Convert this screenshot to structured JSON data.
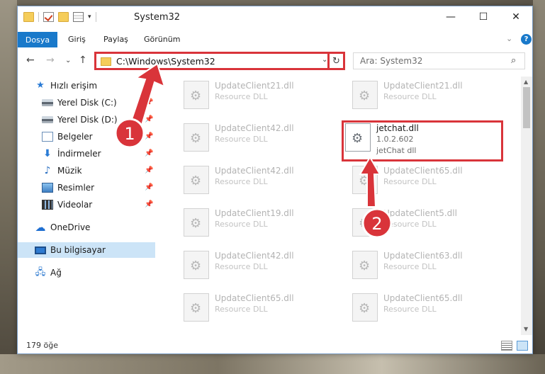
{
  "window": {
    "title": "System32",
    "minimize": "—",
    "maximize": "☐",
    "close": "✕"
  },
  "ribbon": {
    "tabs": [
      "Dosya",
      "Giriş",
      "Paylaş",
      "Görünüm"
    ],
    "collapse": "⌄",
    "help": "?"
  },
  "nav": {
    "back": "←",
    "forward": "→",
    "recent": "⌄",
    "up": "↑",
    "address": "C:\\Windows\\System32",
    "address_dropdown": "⌄",
    "refresh": "↻",
    "search_placeholder": "Ara: System32",
    "search_icon": "⌕"
  },
  "sidebar": {
    "items": [
      {
        "label": "Hızlı erişim",
        "icon": "star-icon"
      },
      {
        "label": "Yerel Disk (C:)",
        "icon": "drive-icon",
        "pinned": true
      },
      {
        "label": "Yerel Disk (D:)",
        "icon": "drive-icon",
        "pinned": true
      },
      {
        "label": "Belgeler",
        "icon": "documents-icon",
        "pinned": true
      },
      {
        "label": "İndirmeler",
        "icon": "download-icon",
        "pinned": true
      },
      {
        "label": "Müzik",
        "icon": "music-icon",
        "pinned": true
      },
      {
        "label": "Resimler",
        "icon": "pictures-icon",
        "pinned": true
      },
      {
        "label": "Videolar",
        "icon": "videos-icon",
        "pinned": true
      },
      {
        "label": "OneDrive",
        "icon": "cloud-icon"
      },
      {
        "label": "Bu bilgisayar",
        "icon": "computer-icon",
        "selected": true
      },
      {
        "label": "Ağ",
        "icon": "network-icon"
      }
    ]
  },
  "files": [
    {
      "name": "UpdateClient21.dll",
      "desc": "Resource DLL"
    },
    {
      "name": "UpdateClient21.dll",
      "desc": "Resource DLL"
    },
    {
      "name": "UpdateClient42.dll",
      "desc": "Resource DLL"
    },
    {
      "name": "jetchat.dll",
      "desc": "1.0.2.602",
      "desc2": "jetChat dll",
      "highlighted": true
    },
    {
      "name": "UpdateClient42.dll",
      "desc": "Resource DLL"
    },
    {
      "name": "UpdateClient65.dll",
      "desc": "Resource DLL"
    },
    {
      "name": "UpdateClient19.dll",
      "desc": "Resource DLL"
    },
    {
      "name": "UpdateClient5.dll",
      "desc": "Resource DLL"
    },
    {
      "name": "UpdateClient42.dll",
      "desc": "Resource DLL"
    },
    {
      "name": "UpdateClient63.dll",
      "desc": "Resource DLL"
    },
    {
      "name": "UpdateClient65.dll",
      "desc": "Resource DLL"
    },
    {
      "name": "UpdateClient65.dll",
      "desc": "Resource DLL"
    }
  ],
  "status": {
    "count": "179 öğe"
  },
  "annotations": {
    "step1": "1",
    "step2": "2",
    "color": "#d9343a"
  }
}
